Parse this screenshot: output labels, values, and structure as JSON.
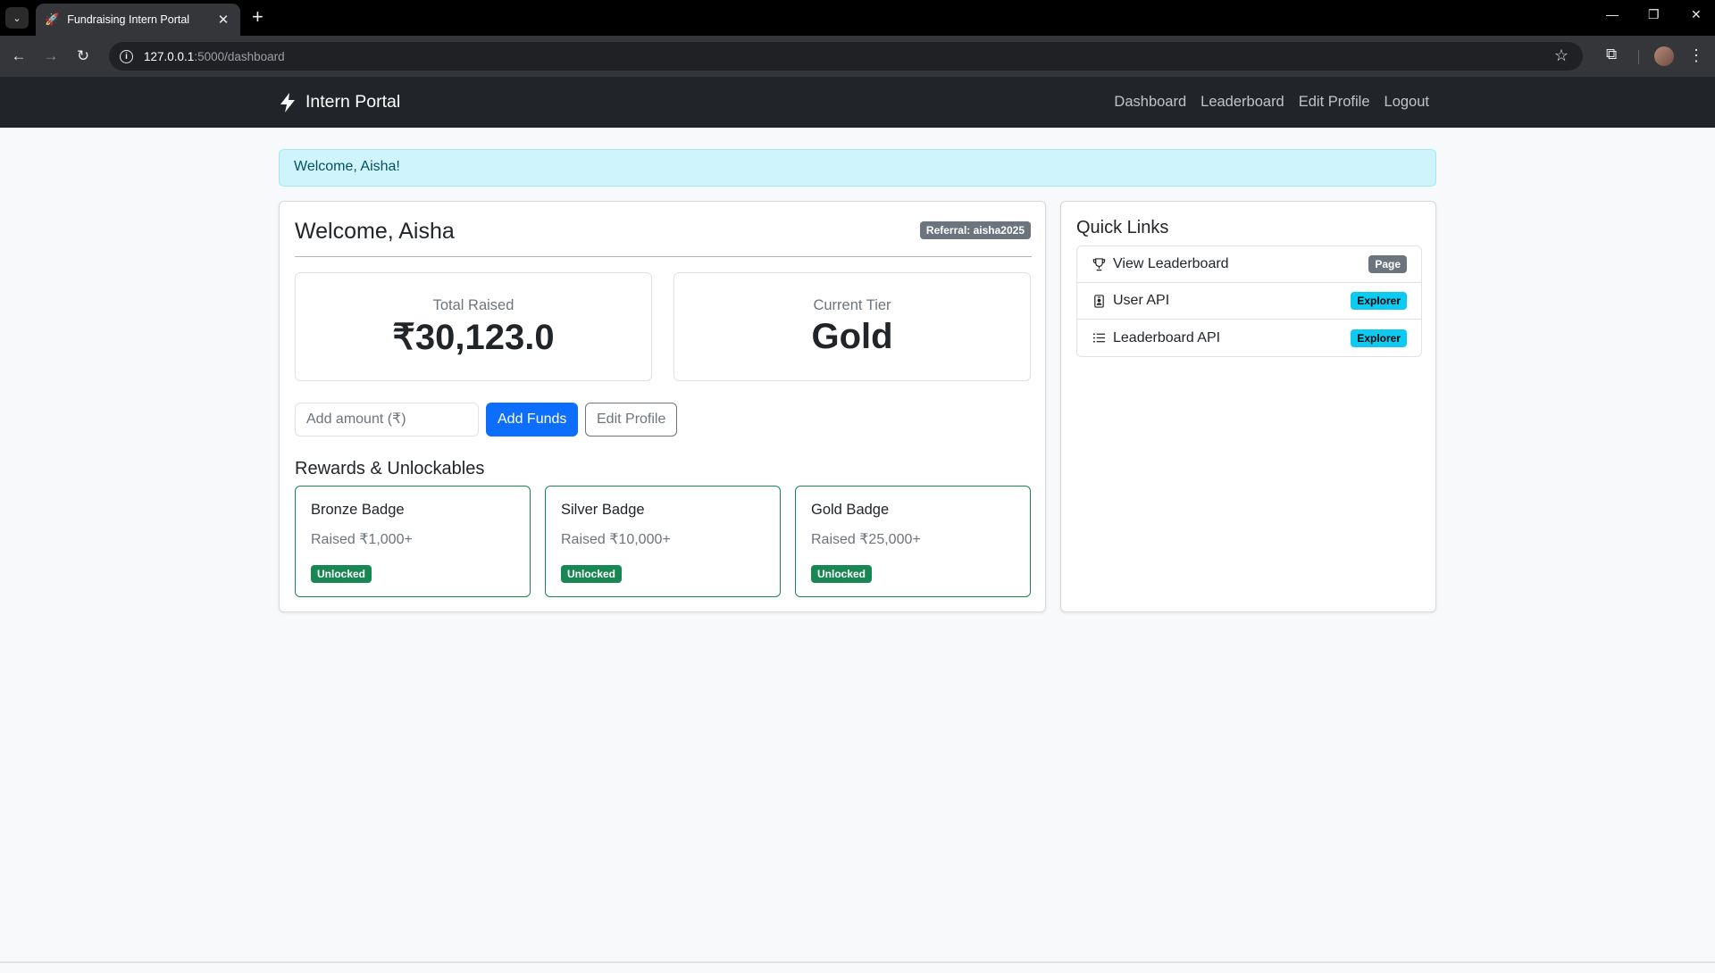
{
  "browser": {
    "tab_title": "Fundraising Intern Portal",
    "url_host": "127.0.0.1",
    "url_path": ":5000/dashboard"
  },
  "navbar": {
    "brand": "Intern Portal",
    "links": [
      "Dashboard",
      "Leaderboard",
      "Edit Profile",
      "Logout"
    ]
  },
  "alert": {
    "text": "Welcome, Aisha!"
  },
  "main": {
    "title": "Welcome, Aisha",
    "referral": "Referral: aisha2025",
    "stats": [
      {
        "label": "Total Raised",
        "value": "₹30,123.0"
      },
      {
        "label": "Current Tier",
        "value": "Gold"
      }
    ],
    "amount_placeholder": "Add amount (₹)",
    "add_funds": "Add Funds",
    "edit_profile": "Edit Profile",
    "rewards_title": "Rewards & Unlockables",
    "rewards": [
      {
        "name": "Bronze Badge",
        "desc": "Raised ₹1,000+",
        "status": "Unlocked"
      },
      {
        "name": "Silver Badge",
        "desc": "Raised ₹10,000+",
        "status": "Unlocked"
      },
      {
        "name": "Gold Badge",
        "desc": "Raised ₹25,000+",
        "status": "Unlocked"
      }
    ]
  },
  "quick_links": {
    "title": "Quick Links",
    "items": [
      {
        "label": "View Leaderboard",
        "badge": "Page",
        "icon": "trophy-icon"
      },
      {
        "label": "User API",
        "badge": "Explorer",
        "icon": "person-badge-icon"
      },
      {
        "label": "Leaderboard API",
        "badge": "Explorer",
        "icon": "list-icon"
      }
    ]
  },
  "colors": {
    "primary": "#0d6efd",
    "success": "#198754",
    "info": "#0dcaf0",
    "dark": "#212529"
  }
}
